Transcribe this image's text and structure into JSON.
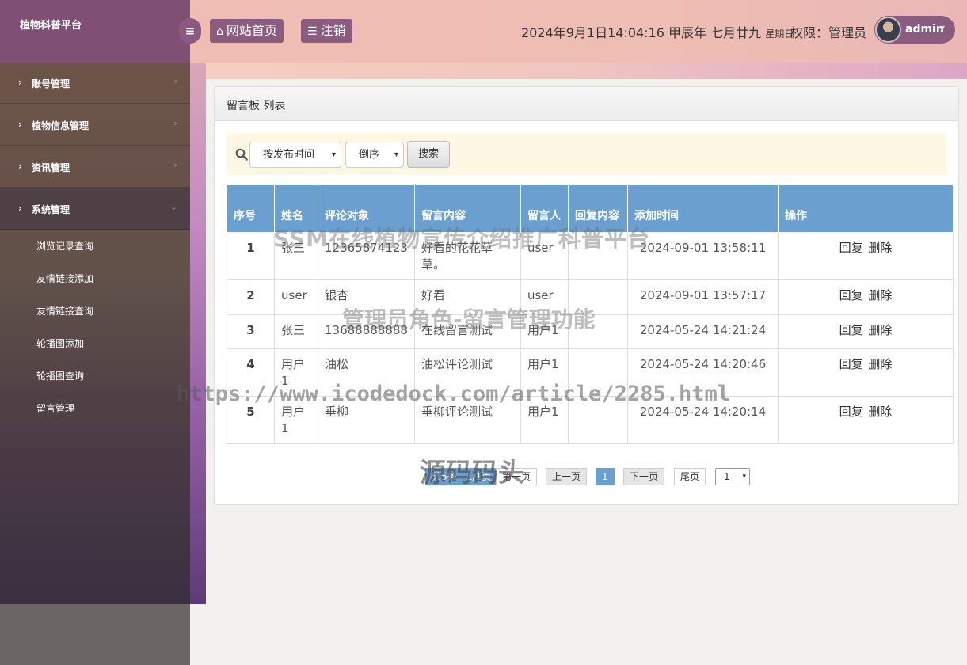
{
  "brand": {
    "title": "植物科普平台"
  },
  "sidebar": {
    "items": [
      {
        "label": "账号管理"
      },
      {
        "label": "植物信息管理"
      },
      {
        "label": "资讯管理"
      },
      {
        "label": "系统管理"
      }
    ],
    "subitems": [
      {
        "label": "浏览记录查询"
      },
      {
        "label": "友情链接添加"
      },
      {
        "label": "友情链接查询"
      },
      {
        "label": "轮播图添加"
      },
      {
        "label": "轮播图查询"
      },
      {
        "label": "留言管理"
      }
    ]
  },
  "header": {
    "home_label": "网站首页",
    "logout_label": "注销",
    "datetime": "2024年9月1日14:04:16 甲辰年 七月廿九",
    "weekday": "星期日",
    "permission": "权限：管理员",
    "username": "admin"
  },
  "panel": {
    "title": "留言板 列表"
  },
  "search": {
    "sort_field": "按发布时间",
    "sort_order": "倒序",
    "button_label": "搜索"
  },
  "table": {
    "headers": [
      "序号",
      "姓名",
      "评论对象",
      "留言内容",
      "留言人",
      "回复内容",
      "添加时间",
      "操作"
    ],
    "rows": [
      {
        "no": "1",
        "name": "张三",
        "target": "12365874123",
        "content": "好看的花花草草。",
        "author": "user",
        "reply": "",
        "time": "2024-09-01 13:58:11",
        "op_reply": "回复",
        "op_delete": "删除"
      },
      {
        "no": "2",
        "name": "user",
        "target": "银杏",
        "content": "好看",
        "author": "user",
        "reply": "",
        "time": "2024-09-01 13:57:17",
        "op_reply": "回复",
        "op_delete": "删除"
      },
      {
        "no": "3",
        "name": "张三",
        "target": "13688888888",
        "content": "在线留言测试",
        "author": "用户1",
        "reply": "",
        "time": "2024-05-24 14:21:24",
        "op_reply": "回复",
        "op_delete": "删除"
      },
      {
        "no": "4",
        "name": "用户1",
        "target": "油松",
        "content": "油松评论测试",
        "author": "用户1",
        "reply": "",
        "time": "2024-05-24 14:20:46",
        "op_reply": "回复",
        "op_delete": "删除"
      },
      {
        "no": "5",
        "name": "用户1",
        "target": "垂柳",
        "content": "垂柳评论测试",
        "author": "用户1",
        "reply": "",
        "time": "2024-05-24 14:20:14",
        "op_reply": "回复",
        "op_delete": "删除"
      }
    ]
  },
  "pager": {
    "total": "共5条",
    "pages": "1/1页",
    "first": "第一页",
    "prev": "上一页",
    "current": "1",
    "next": "下一页",
    "last": "尾页",
    "jump": "1"
  },
  "watermarks": {
    "line1": "SSM在线植物宣传介绍推广科普平台",
    "line2": "管理员角色-留言管理功能",
    "line3": "https://www.icodedock.com/article/2285.html",
    "line4": "源码码头"
  }
}
